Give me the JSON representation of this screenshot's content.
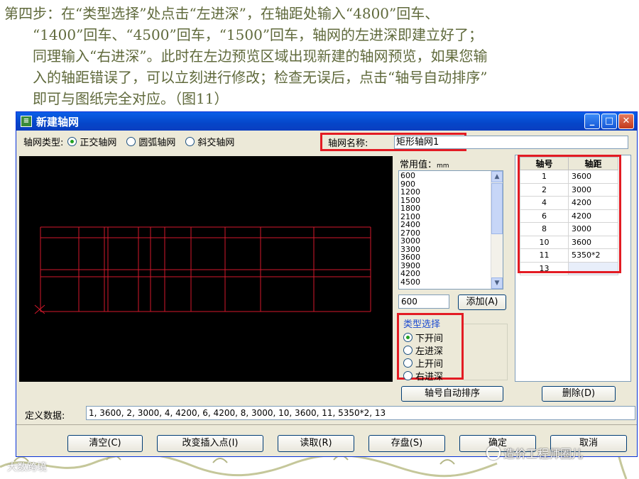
{
  "slide": {
    "lines": [
      "第四步：在“类型选择”处点击“左进深”，在轴距处输入“4800”回车、",
      "“1400”回车、“4500”回车，“1500”回车，轴网的左进深即建立好了；",
      "同理输入“右进深”。此时在左边预览区域出现新建的轴网预览，如果您输",
      "入的轴距错误了，可以立刻进行修改；检查无误后，点击“轴号自动排序”",
      "即可与图纸完全对应。（图11）"
    ],
    "text_color": "#606a3c"
  },
  "window": {
    "title": "新建轴网",
    "minimize": "_",
    "maximize": "□",
    "close": "✕"
  },
  "grid_type": {
    "label": "轴网类型:",
    "options": [
      "正交轴网",
      "圆弧轴网",
      "斜交轴网"
    ],
    "selected": "正交轴网"
  },
  "grid_name": {
    "label": "轴网名称:",
    "value": "矩形轴网1"
  },
  "common_values": {
    "label": "常用值：",
    "unit": "mm",
    "items": [
      "600",
      "900",
      "1200",
      "1500",
      "1800",
      "2100",
      "2400",
      "2700",
      "3000",
      "3300",
      "3600",
      "3900",
      "4200",
      "4500"
    ]
  },
  "value_input": "600",
  "add_button": "添加(A)",
  "type_select": {
    "title": "类型选择",
    "options": [
      "下开间",
      "左进深",
      "上开间",
      "右进深"
    ],
    "selected": "下开间"
  },
  "axis_table": {
    "headers": [
      "轴号",
      "轴距"
    ],
    "rows": [
      [
        "1",
        "3600"
      ],
      [
        "2",
        "3000"
      ],
      [
        "4",
        "4200"
      ],
      [
        "6",
        "4200"
      ],
      [
        "8",
        "3000"
      ],
      [
        "10",
        "3600"
      ],
      [
        "11",
        "5350*2"
      ],
      [
        "13",
        ""
      ]
    ]
  },
  "sort_button": "轴号自动排序",
  "delete_button": "删除(D)",
  "definition": {
    "label": "定义数据:",
    "value": "1, 3600, 2, 3000, 4, 4200, 6, 4200, 8, 3000, 10, 3600, 11, 5350*2, 13"
  },
  "bottom_buttons": [
    "清空(C)",
    "改变插入点(I)",
    "读取(R)",
    "存盘(S)",
    "确定",
    "取消"
  ],
  "watermark": "造价工程师圈儿",
  "watermark2": "大数跨境",
  "colors": {
    "highlight": "#e31b23",
    "preview_bg": "#000000",
    "grid_lines": "#d4182b"
  }
}
